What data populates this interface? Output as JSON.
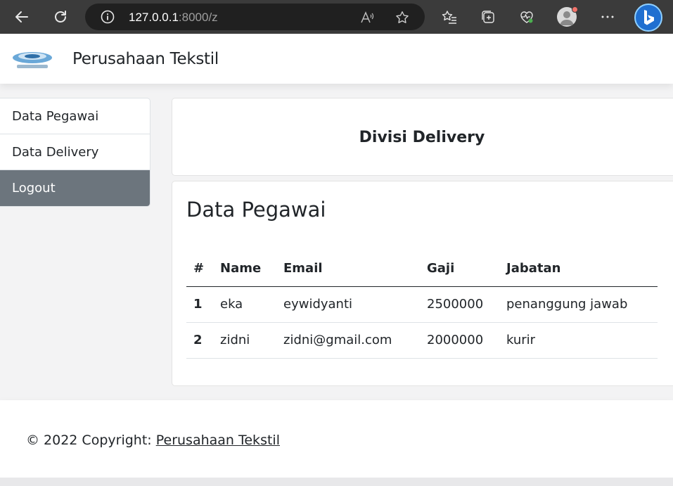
{
  "browser": {
    "url_host": "127.0.0.1",
    "url_rest": ":8000/z"
  },
  "header": {
    "title": "Perusahaan Tekstil"
  },
  "sidebar": {
    "items": [
      {
        "label": "Data Pegawai",
        "active": false
      },
      {
        "label": "Data Delivery",
        "active": false
      },
      {
        "label": "Logout",
        "active": true
      }
    ]
  },
  "division": {
    "title": "Divisi Delivery"
  },
  "table": {
    "heading": "Data Pegawai",
    "columns": [
      "#",
      "Name",
      "Email",
      "Gaji",
      "Jabatan"
    ],
    "rows": [
      [
        "1",
        "eka",
        "eywidyanti",
        "2500000",
        "penanggung jawab"
      ],
      [
        "2",
        "zidni",
        "zidni@gmail.com",
        "2000000",
        "kurir"
      ]
    ]
  },
  "footer": {
    "prefix": "© 2022 Copyright: ",
    "link": "Perusahaan Tekstil"
  },
  "colors": {
    "chrome": "#3b3b3b",
    "active_sidebar": "#6c757d"
  }
}
